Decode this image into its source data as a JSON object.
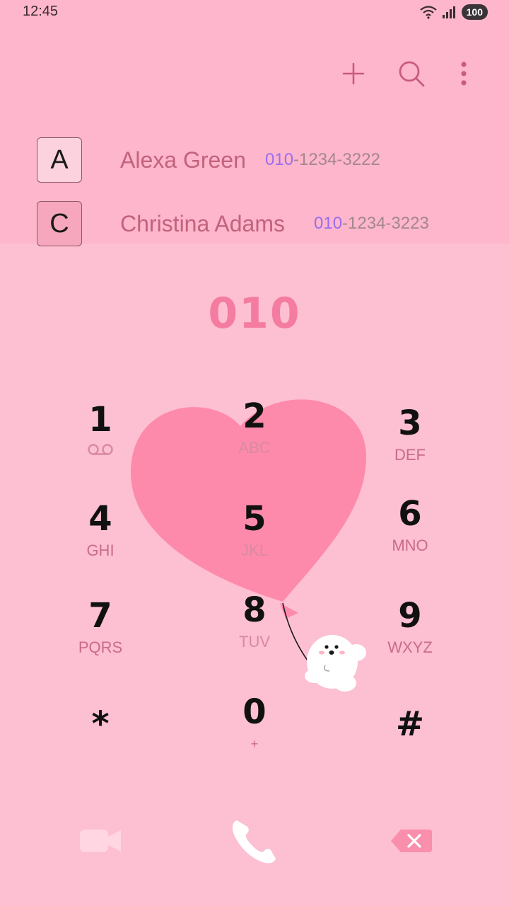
{
  "status": {
    "time": "12:45",
    "battery": "100"
  },
  "toolbar": {
    "add_icon": "plus-icon",
    "search_icon": "search-icon",
    "more_icon": "more-vertical-icon"
  },
  "contacts": [
    {
      "letter": "A",
      "name": "Alexa Green",
      "number_match": "010",
      "number_rest": "-1234-3222"
    },
    {
      "letter": "C",
      "name": "Christina Adams",
      "number_match": "010",
      "number_rest": "-1234-3223"
    }
  ],
  "dialer": {
    "display": "010",
    "keys": [
      {
        "digit": "1",
        "sub": "voicemail-icon"
      },
      {
        "digit": "2",
        "sub": "ABC"
      },
      {
        "digit": "3",
        "sub": "DEF"
      },
      {
        "digit": "4",
        "sub": "GHI"
      },
      {
        "digit": "5",
        "sub": "JKL"
      },
      {
        "digit": "6",
        "sub": "MNO"
      },
      {
        "digit": "7",
        "sub": "PQRS"
      },
      {
        "digit": "8",
        "sub": "TUV"
      },
      {
        "digit": "9",
        "sub": "WXYZ"
      },
      {
        "digit": "*",
        "sub": ""
      },
      {
        "digit": "0",
        "sub": "+"
      },
      {
        "digit": "#",
        "sub": ""
      }
    ]
  },
  "bottom": {
    "video_icon": "video-call-icon",
    "call_icon": "phone-icon",
    "backspace_icon": "backspace-icon"
  },
  "colors": {
    "accent": "#f47ca0",
    "top_background": "#fdb6cb",
    "dialer_background": "#fdbfd2",
    "heart": "#fe8aab"
  }
}
